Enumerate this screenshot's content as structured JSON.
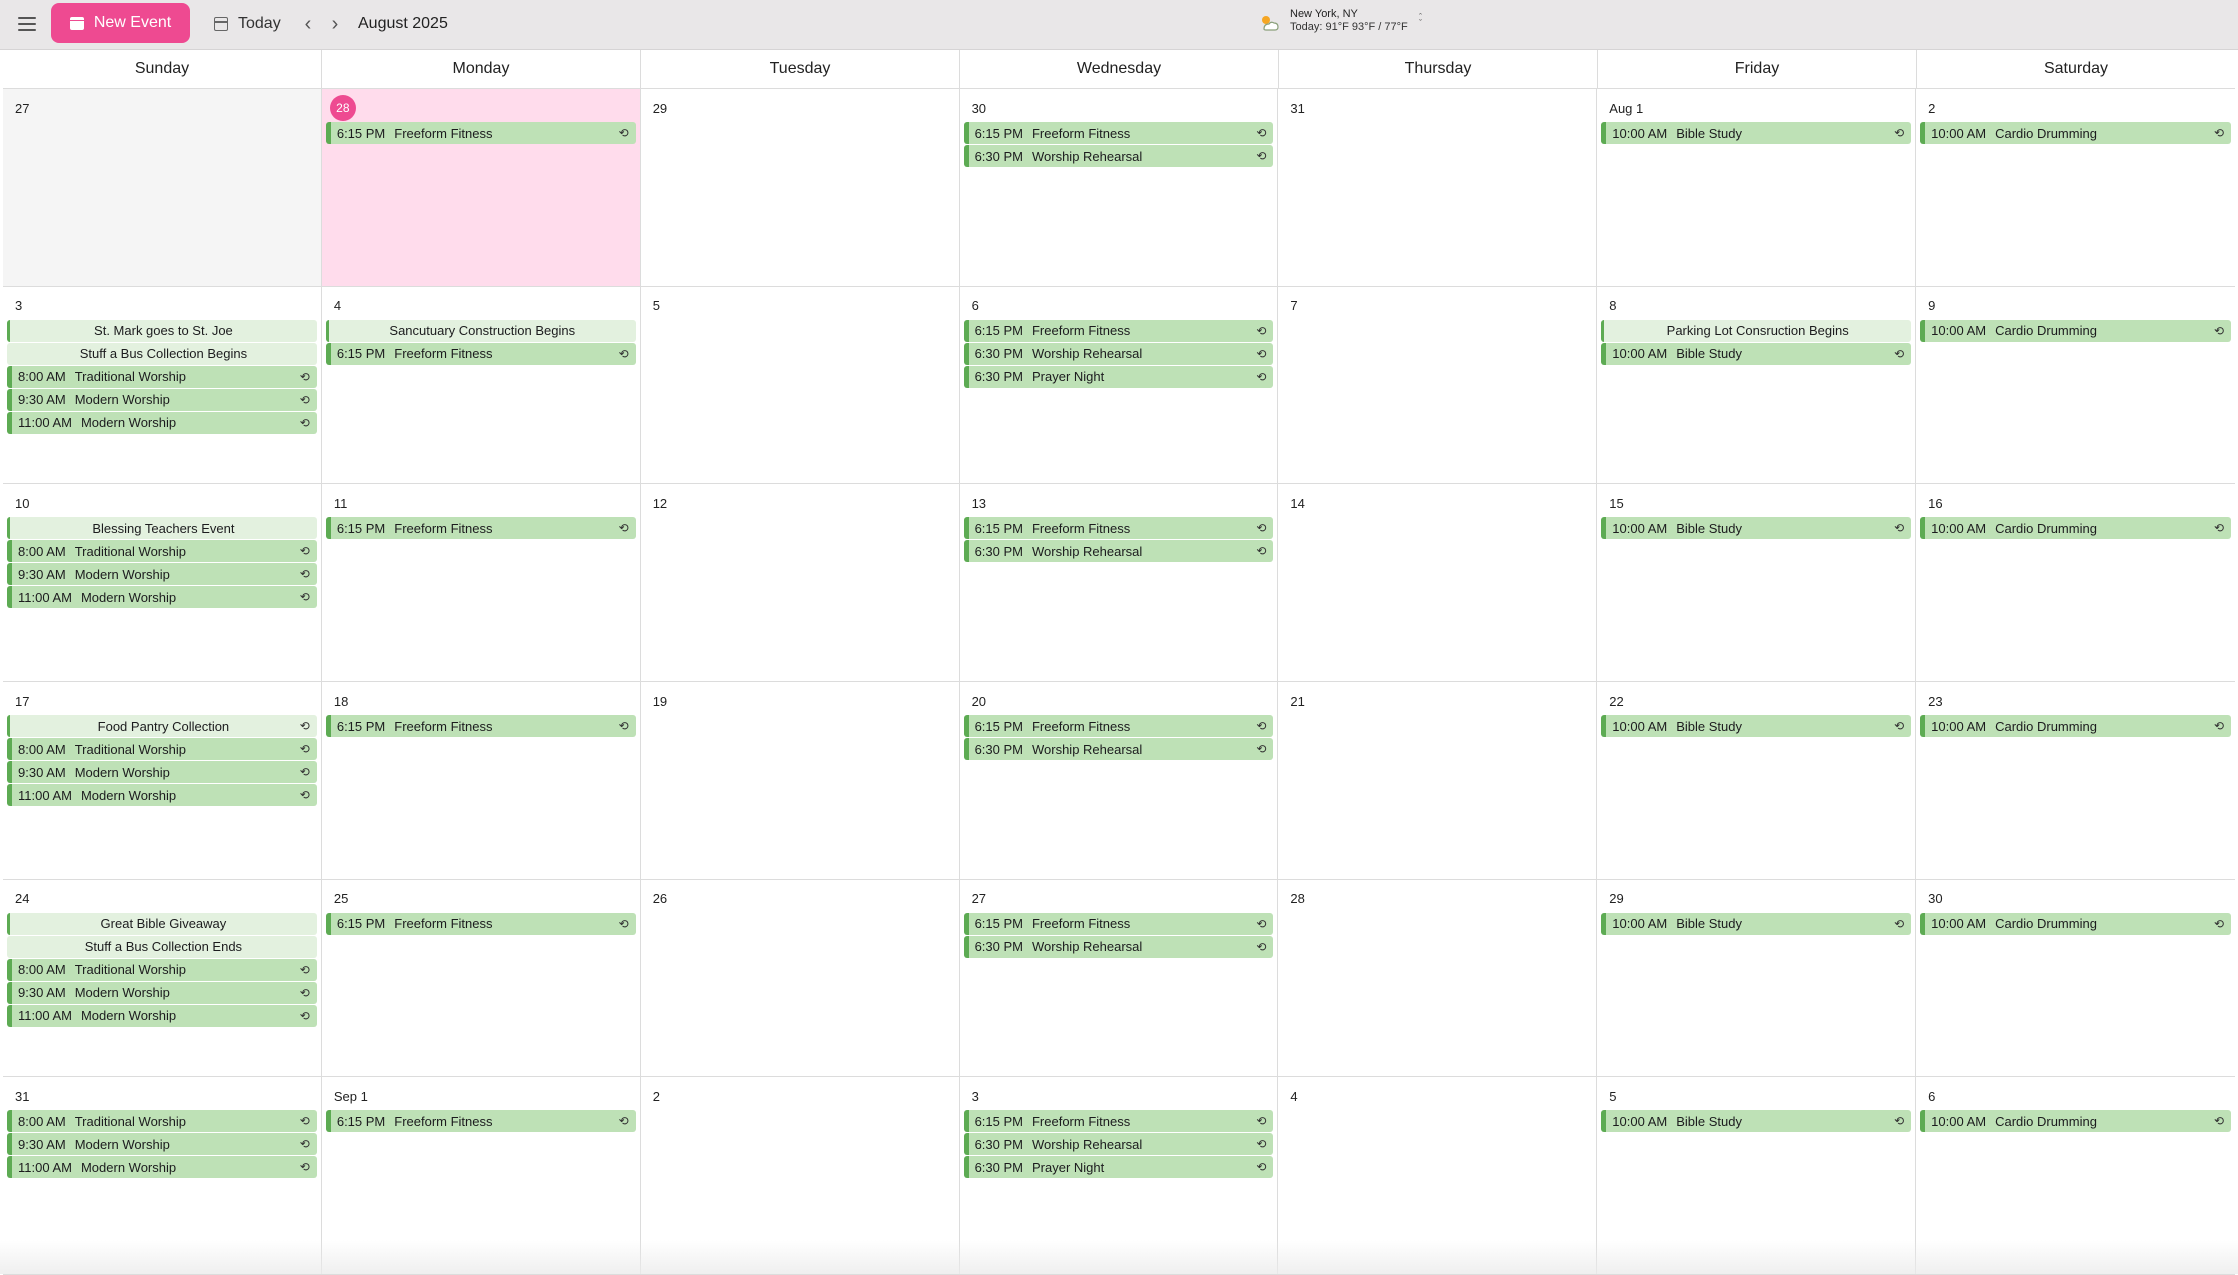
{
  "toolbar": {
    "new_event_label": "New Event",
    "today_label": "Today",
    "month_title": "August 2025"
  },
  "weather": {
    "location": "New York, NY",
    "today_prefix": "Today: 91°F",
    "range": "93°F / 77°F"
  },
  "colors": {
    "accent": "#ee4a91",
    "event_bg": "#bee1b6",
    "event_bar": "#5dab53",
    "allday_bg": "#e3f1df",
    "today_bg": "#ffdcec"
  },
  "weekdays": [
    "Sunday",
    "Monday",
    "Tuesday",
    "Wednesday",
    "Thursday",
    "Friday",
    "Saturday"
  ],
  "weeks": [
    [
      {
        "label": "27",
        "state": "out",
        "events": []
      },
      {
        "label": "28",
        "state": "today",
        "events": [
          {
            "time": "6:15 PM",
            "title": "Freeform Fitness",
            "repeat": true
          }
        ]
      },
      {
        "label": "29",
        "events": []
      },
      {
        "label": "30",
        "events": [
          {
            "time": "6:15 PM",
            "title": "Freeform Fitness",
            "repeat": true
          },
          {
            "time": "6:30 PM",
            "title": "Worship Rehearsal",
            "repeat": true
          }
        ]
      },
      {
        "label": "31",
        "events": []
      },
      {
        "label": "Aug 1",
        "events": [
          {
            "time": "10:00 AM",
            "title": "Bible Study",
            "repeat": true
          }
        ]
      },
      {
        "label": "2",
        "events": [
          {
            "time": "10:00 AM",
            "title": "Cardio Drumming",
            "repeat": true
          }
        ]
      }
    ],
    [
      {
        "label": "3",
        "events": [
          {
            "title": "St. Mark goes to St. Joe",
            "allday": true,
            "first": true
          },
          {
            "title": "Stuff a Bus Collection Begins",
            "allday": true
          },
          {
            "time": "8:00 AM",
            "title": "Traditional Worship",
            "repeat": true
          },
          {
            "time": "9:30 AM",
            "title": "Modern Worship",
            "repeat": true
          },
          {
            "time": "11:00 AM",
            "title": "Modern Worship",
            "repeat": true
          }
        ]
      },
      {
        "label": "4",
        "events": [
          {
            "title": "Sancutuary Construction Begins",
            "allday": true,
            "first": true
          },
          {
            "time": "6:15 PM",
            "title": "Freeform Fitness",
            "repeat": true
          }
        ]
      },
      {
        "label": "5",
        "events": []
      },
      {
        "label": "6",
        "events": [
          {
            "time": "6:15 PM",
            "title": "Freeform Fitness",
            "repeat": true
          },
          {
            "time": "6:30 PM",
            "title": "Worship Rehearsal",
            "repeat": true
          },
          {
            "time": "6:30 PM",
            "title": "Prayer Night",
            "repeat": true
          }
        ]
      },
      {
        "label": "7",
        "events": []
      },
      {
        "label": "8",
        "events": [
          {
            "title": "Parking Lot Consruction Begins",
            "allday": true,
            "first": true
          },
          {
            "time": "10:00 AM",
            "title": "Bible Study",
            "repeat": true
          }
        ]
      },
      {
        "label": "9",
        "events": [
          {
            "time": "10:00 AM",
            "title": "Cardio Drumming",
            "repeat": true
          }
        ]
      }
    ],
    [
      {
        "label": "10",
        "events": [
          {
            "title": "Blessing Teachers Event",
            "allday": true,
            "first": true
          },
          {
            "time": "8:00 AM",
            "title": "Traditional Worship",
            "repeat": true
          },
          {
            "time": "9:30 AM",
            "title": "Modern Worship",
            "repeat": true
          },
          {
            "time": "11:00 AM",
            "title": "Modern Worship",
            "repeat": true
          }
        ]
      },
      {
        "label": "11",
        "events": [
          {
            "time": "6:15 PM",
            "title": "Freeform Fitness",
            "repeat": true
          }
        ]
      },
      {
        "label": "12",
        "events": []
      },
      {
        "label": "13",
        "events": [
          {
            "time": "6:15 PM",
            "title": "Freeform Fitness",
            "repeat": true
          },
          {
            "time": "6:30 PM",
            "title": "Worship Rehearsal",
            "repeat": true
          }
        ]
      },
      {
        "label": "14",
        "events": []
      },
      {
        "label": "15",
        "events": [
          {
            "time": "10:00 AM",
            "title": "Bible Study",
            "repeat": true
          }
        ]
      },
      {
        "label": "16",
        "events": [
          {
            "time": "10:00 AM",
            "title": "Cardio Drumming",
            "repeat": true
          }
        ]
      }
    ],
    [
      {
        "label": "17",
        "events": [
          {
            "title": "Food Pantry Collection",
            "allday": true,
            "first": true,
            "repeat": true
          },
          {
            "time": "8:00 AM",
            "title": "Traditional Worship",
            "repeat": true
          },
          {
            "time": "9:30 AM",
            "title": "Modern Worship",
            "repeat": true
          },
          {
            "time": "11:00 AM",
            "title": "Modern Worship",
            "repeat": true
          }
        ]
      },
      {
        "label": "18",
        "events": [
          {
            "time": "6:15 PM",
            "title": "Freeform Fitness",
            "repeat": true
          }
        ]
      },
      {
        "label": "19",
        "events": []
      },
      {
        "label": "20",
        "events": [
          {
            "time": "6:15 PM",
            "title": "Freeform Fitness",
            "repeat": true
          },
          {
            "time": "6:30 PM",
            "title": "Worship Rehearsal",
            "repeat": true
          }
        ]
      },
      {
        "label": "21",
        "events": []
      },
      {
        "label": "22",
        "events": [
          {
            "time": "10:00 AM",
            "title": "Bible Study",
            "repeat": true
          }
        ]
      },
      {
        "label": "23",
        "events": [
          {
            "time": "10:00 AM",
            "title": "Cardio Drumming",
            "repeat": true
          }
        ]
      }
    ],
    [
      {
        "label": "24",
        "events": [
          {
            "title": "Great Bible Giveaway",
            "allday": true,
            "first": true
          },
          {
            "title": "Stuff a Bus Collection Ends",
            "allday": true
          },
          {
            "time": "8:00 AM",
            "title": "Traditional Worship",
            "repeat": true
          },
          {
            "time": "9:30 AM",
            "title": "Modern Worship",
            "repeat": true
          },
          {
            "time": "11:00 AM",
            "title": "Modern Worship",
            "repeat": true
          }
        ]
      },
      {
        "label": "25",
        "events": [
          {
            "time": "6:15 PM",
            "title": "Freeform Fitness",
            "repeat": true
          }
        ]
      },
      {
        "label": "26",
        "events": []
      },
      {
        "label": "27",
        "events": [
          {
            "time": "6:15 PM",
            "title": "Freeform Fitness",
            "repeat": true
          },
          {
            "time": "6:30 PM",
            "title": "Worship Rehearsal",
            "repeat": true
          }
        ]
      },
      {
        "label": "28",
        "events": []
      },
      {
        "label": "29",
        "events": [
          {
            "time": "10:00 AM",
            "title": "Bible Study",
            "repeat": true
          }
        ]
      },
      {
        "label": "30",
        "events": [
          {
            "time": "10:00 AM",
            "title": "Cardio Drumming",
            "repeat": true
          }
        ]
      }
    ],
    [
      {
        "label": "31",
        "events": [
          {
            "time": "8:00 AM",
            "title": "Traditional Worship",
            "repeat": true
          },
          {
            "time": "9:30 AM",
            "title": "Modern Worship",
            "repeat": true
          },
          {
            "time": "11:00 AM",
            "title": "Modern Worship",
            "repeat": true
          }
        ]
      },
      {
        "label": "Sep 1",
        "events": [
          {
            "time": "6:15 PM",
            "title": "Freeform Fitness",
            "repeat": true
          }
        ]
      },
      {
        "label": "2",
        "events": []
      },
      {
        "label": "3",
        "events": [
          {
            "time": "6:15 PM",
            "title": "Freeform Fitness",
            "repeat": true
          },
          {
            "time": "6:30 PM",
            "title": "Worship Rehearsal",
            "repeat": true
          },
          {
            "time": "6:30 PM",
            "title": "Prayer Night",
            "repeat": true
          }
        ]
      },
      {
        "label": "4",
        "events": []
      },
      {
        "label": "5",
        "events": [
          {
            "time": "10:00 AM",
            "title": "Bible Study",
            "repeat": true
          }
        ]
      },
      {
        "label": "6",
        "events": [
          {
            "time": "10:00 AM",
            "title": "Cardio Drumming",
            "repeat": true
          }
        ]
      }
    ]
  ]
}
